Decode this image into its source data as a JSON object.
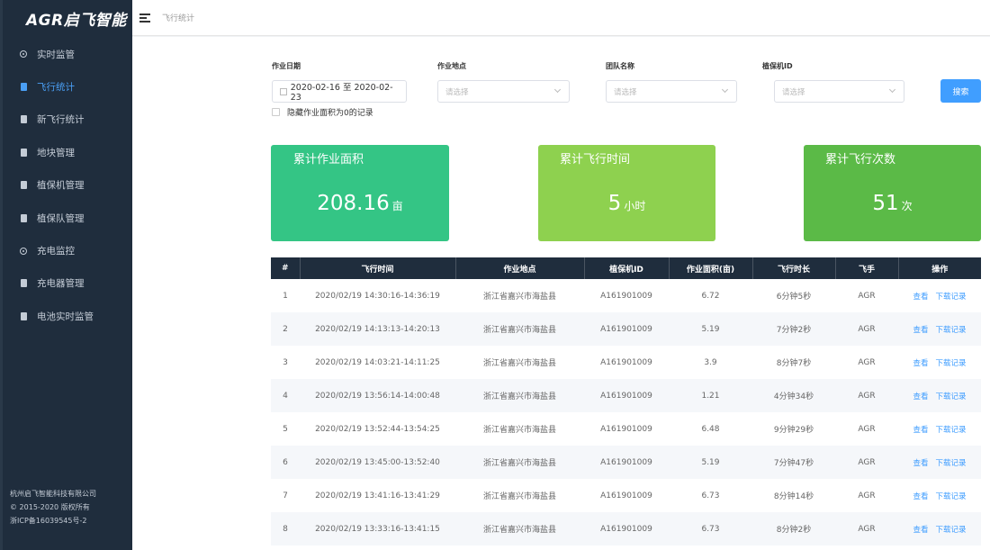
{
  "sidebar": {
    "logo": "AGR启飞智能",
    "items": [
      {
        "label": "实时监管",
        "icon": "eye-icon"
      },
      {
        "label": "飞行统计",
        "icon": "document-icon"
      },
      {
        "label": "新飞行统计",
        "icon": "document-icon"
      },
      {
        "label": "地块管理",
        "icon": "grid-icon"
      },
      {
        "label": "植保机管理",
        "icon": "list-icon"
      },
      {
        "label": "植保队管理",
        "icon": "table-icon"
      },
      {
        "label": "充电监控",
        "icon": "eye-icon"
      },
      {
        "label": "充电器管理",
        "icon": "plug-icon"
      },
      {
        "label": "电池实时监管",
        "icon": "battery-icon"
      }
    ],
    "active_index": 1,
    "footer": [
      "杭州启飞智能科技有限公司",
      "© 2015-2020 版权所有",
      "浙ICP备16039545号-2"
    ]
  },
  "header": {
    "breadcrumb": "飞行统计"
  },
  "filters": {
    "date_label": "作业日期",
    "date_value": "2020-02-16 至 2020-02-23",
    "location_label": "作业地点",
    "location_placeholder": "请选择",
    "team_label": "团队名称",
    "team_placeholder": "请选择",
    "drone_label": "植保机ID",
    "drone_placeholder": "请选择",
    "search_label": "搜索",
    "hide_zero_label": "隐藏作业面积为0的记录"
  },
  "cards": [
    {
      "title": "累计作业面积",
      "value": "208.16",
      "unit": "亩",
      "color": "#34c585"
    },
    {
      "title": "累计飞行时间",
      "value": "5",
      "unit": "小时",
      "color": "#8ed14f"
    },
    {
      "title": "累计飞行次数",
      "value": "51",
      "unit": "次",
      "color": "#5bba47"
    }
  ],
  "table": {
    "headers": [
      "#",
      "飞行时间",
      "作业地点",
      "植保机ID",
      "作业面积(亩)",
      "飞行时长",
      "飞手",
      "操作"
    ],
    "view_label": "查看",
    "download_label": "下载记录",
    "rows": [
      {
        "no": "1",
        "time": "2020/02/19 14:30:16-14:36:19",
        "location": "浙江省嘉兴市海盐县",
        "drone_id": "A161901009",
        "area": "6.72",
        "duration": "6分钟5秒",
        "pilot": "AGR"
      },
      {
        "no": "2",
        "time": "2020/02/19 14:13:13-14:20:13",
        "location": "浙江省嘉兴市海盐县",
        "drone_id": "A161901009",
        "area": "5.19",
        "duration": "7分钟2秒",
        "pilot": "AGR"
      },
      {
        "no": "3",
        "time": "2020/02/19 14:03:21-14:11:25",
        "location": "浙江省嘉兴市海盐县",
        "drone_id": "A161901009",
        "area": "3.9",
        "duration": "8分钟7秒",
        "pilot": "AGR"
      },
      {
        "no": "4",
        "time": "2020/02/19 13:56:14-14:00:48",
        "location": "浙江省嘉兴市海盐县",
        "drone_id": "A161901009",
        "area": "1.21",
        "duration": "4分钟34秒",
        "pilot": "AGR"
      },
      {
        "no": "5",
        "time": "2020/02/19 13:52:44-13:54:25",
        "location": "浙江省嘉兴市海盐县",
        "drone_id": "A161901009",
        "area": "6.48",
        "duration": "9分钟29秒",
        "pilot": "AGR"
      },
      {
        "no": "6",
        "time": "2020/02/19 13:45:00-13:52:40",
        "location": "浙江省嘉兴市海盐县",
        "drone_id": "A161901009",
        "area": "5.19",
        "duration": "7分钟47秒",
        "pilot": "AGR"
      },
      {
        "no": "7",
        "time": "2020/02/19 13:41:16-13:41:29",
        "location": "浙江省嘉兴市海盐县",
        "drone_id": "A161901009",
        "area": "6.73",
        "duration": "8分钟14秒",
        "pilot": "AGR"
      },
      {
        "no": "8",
        "time": "2020/02/19 13:33:16-13:41:15",
        "location": "浙江省嘉兴市海盐县",
        "drone_id": "A161901009",
        "area": "6.73",
        "duration": "8分钟2秒",
        "pilot": "AGR"
      }
    ]
  }
}
